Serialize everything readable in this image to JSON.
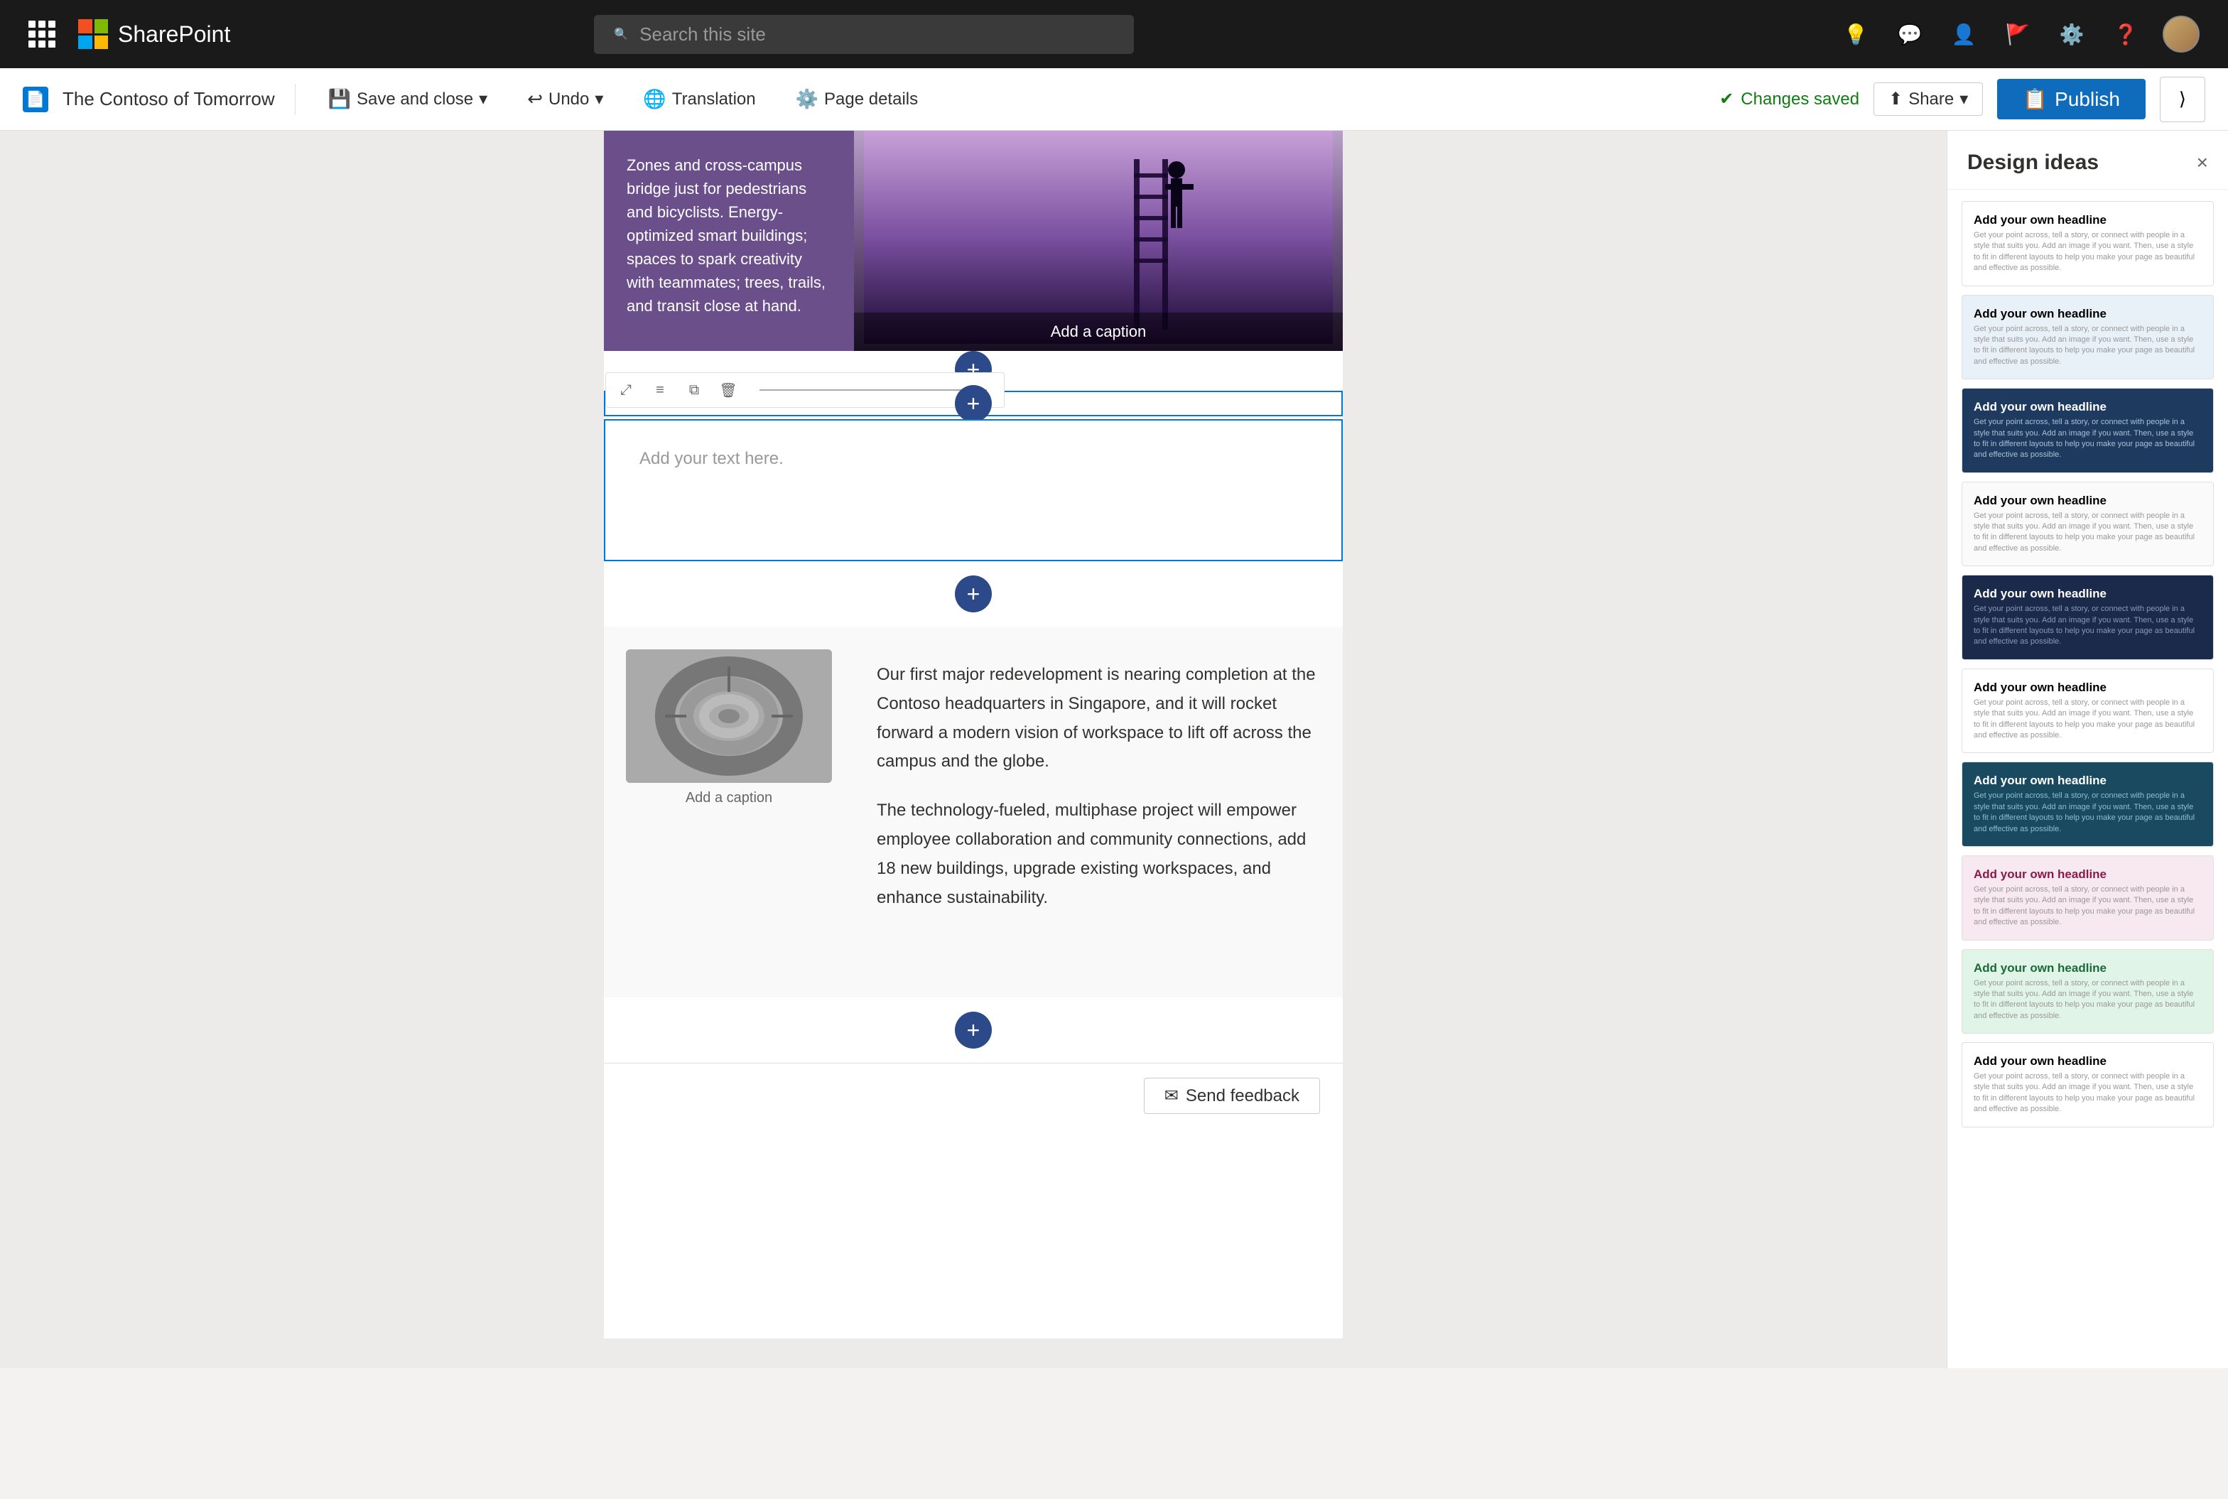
{
  "app": {
    "name": "SharePoint",
    "search_placeholder": "Search this site"
  },
  "toolbar": {
    "page_icon": "SP",
    "site_name": "The Contoso of Tomorrow",
    "save_close_label": "Save and close",
    "undo_label": "Undo",
    "translation_label": "Translation",
    "page_details_label": "Page details",
    "changes_saved_label": "Changes saved",
    "share_label": "Share",
    "publish_label": "Publish"
  },
  "design_panel": {
    "title": "Design ideas",
    "close_label": "×",
    "cards": [
      {
        "id": 1,
        "theme": "card-white",
        "headline": "Add your own headline",
        "body": "Get your point across, tell a story, or connect with people in a style that suits you. Add an image if you want. Then, use a style to fit in different layouts to help you make your page as beautiful and effective as possible."
      },
      {
        "id": 2,
        "theme": "card-light-blue",
        "headline": "Add your own headline",
        "body": "Get your point across, tell a story, or connect with people in a style that suits you. Add an image if you want. Then, use a style to fit in different layouts to help you make your page as beautiful and effective as possible."
      },
      {
        "id": 3,
        "theme": "card-dark-blue",
        "headline": "Add your own headline",
        "body": "Get your point across, tell a story, or connect with people in a style that suits you. Add an image if you want. Then, use a style to fit in different layouts to help you make your page as beautiful and effective as possible."
      },
      {
        "id": 4,
        "theme": "card-white-plain",
        "headline": "Add your own headline",
        "body": "Get your point across, tell a story, or connect with people in a style that suits you. Add an image if you want. Then, use a style to fit in different layouts to help you make your page as beautiful and effective as possible."
      },
      {
        "id": 5,
        "theme": "card-navy",
        "headline": "Add your own headline",
        "body": "Get your point across, tell a story, or connect with people in a style that suits you. Add an image if you want. Then, use a style to fit in different layouts to help you make your page as beautiful and effective as possible."
      },
      {
        "id": 6,
        "theme": "card-white2",
        "headline": "Add your own headline",
        "body": "Get your point across, tell a story, or connect with people in a style that suits you. Add an image if you want. Then, use a style to fit in different layouts to help you make your page as beautiful and effective as possible."
      },
      {
        "id": 7,
        "theme": "card-teal",
        "headline": "Add your own headline",
        "body": "Get your point across, tell a story, or connect with people in a style that suits you. Add an image if you want. Then, use a style to fit in different layouts to help you make your page as beautiful and effective as possible."
      },
      {
        "id": 8,
        "theme": "card-pink",
        "headline": "Add your own headline",
        "body": "Get your point across, tell a story, or connect with people in a style that suits you. Add an image if you want. Then, use a style to fit in different layouts to help you make your page as beautiful and effective as possible."
      },
      {
        "id": 9,
        "theme": "card-cyan-green",
        "headline": "Add your own headline",
        "body": "Get your point across, tell a story, or connect with people in a style that suits you. Add an image if you want. Then, use a style to fit in different layouts to help you make your page as beautiful and effective as possible."
      },
      {
        "id": 10,
        "theme": "card-white3",
        "headline": "Add your own headline",
        "body": "Get your point across, tell a story, or connect with people in a style that suits you. Add an image if you want. Then, use a style to fit in different layouts to help you make your page as beautiful and effective as possible."
      }
    ]
  },
  "editor": {
    "text_content": "Zones and cross-campus bridge just for pedestrians and bicyclists. Energy-optimized smart buildings; spaces to spark creativity with teammates; trees, trails, and transit close at hand.",
    "image_caption_1": "Add a caption",
    "text_placeholder": "Add your text here.",
    "para1": "Our first major redevelopment is nearing completion at the Contoso headquarters in Singapore, and it will rocket forward a modern vision of workspace to lift off across the campus and the globe.",
    "para2": "The technology-fueled, multiphase project will empower employee collaboration and community connections, add 18 new buildings, upgrade existing workspaces, and enhance sustainability.",
    "image_caption_2": "Add a caption"
  },
  "feedback": {
    "send_label": "Send feedback"
  }
}
